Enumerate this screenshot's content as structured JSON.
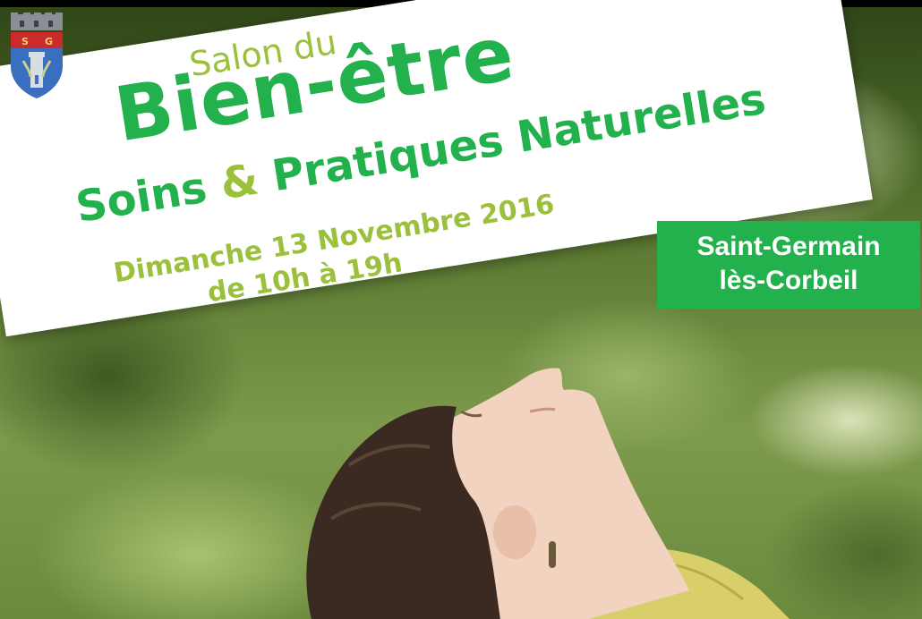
{
  "poster": {
    "salon": "Salon du",
    "title": "Bien-être",
    "subtitle_part1": "Soins ",
    "subtitle_amp": "&",
    "subtitle_part2": " Pratiques Naturelles",
    "date_line1": "Dimanche 13 Novembre 2016",
    "date_line2": "de 10h à 19h",
    "location_line1": "Saint-Germain",
    "location_line2": "lès-Corbeil"
  },
  "crest": {
    "letters": "S G"
  },
  "colors": {
    "green": "#22b14c",
    "light_green": "#9bc13c",
    "white": "#ffffff"
  },
  "icons": {
    "crest": "coat-of-arms-icon"
  }
}
